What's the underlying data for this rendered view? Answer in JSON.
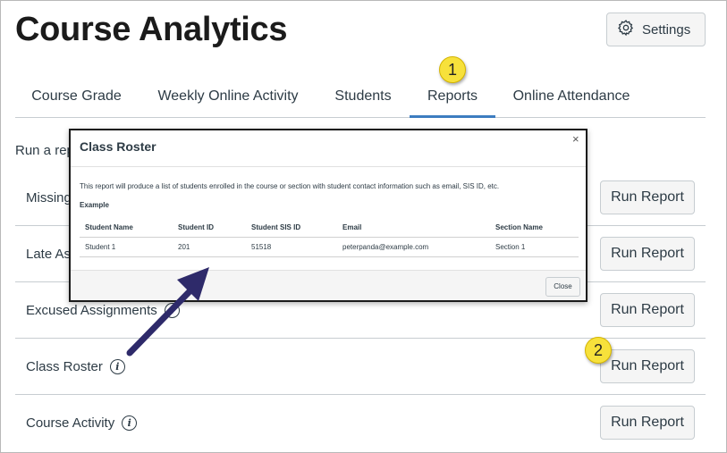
{
  "page": {
    "title": "Course Analytics"
  },
  "header": {
    "settings_label": "Settings",
    "settings_icon": "gear-icon"
  },
  "tabs": [
    {
      "label": "Course Grade",
      "active": false
    },
    {
      "label": "Weekly Online Activity",
      "active": false
    },
    {
      "label": "Students",
      "active": false
    },
    {
      "label": "Reports",
      "active": true
    },
    {
      "label": "Online Attendance",
      "active": false
    }
  ],
  "callouts": {
    "first": "1",
    "second": "2"
  },
  "main": {
    "intro_visible": "Run a rep"
  },
  "reports": [
    {
      "label": "Missing",
      "button": "Run Report"
    },
    {
      "label": "Late As",
      "button": "Run Report"
    },
    {
      "label": "Excused Assignments",
      "button": "Run Report"
    },
    {
      "label": "Class Roster",
      "button": "Run Report"
    },
    {
      "label": "Course Activity",
      "button": "Run Report"
    }
  ],
  "modal": {
    "title": "Class Roster",
    "close_glyph": "×",
    "description": "This report will produce a list of students enrolled in the course or section with student contact information such as email, SIS ID, etc.",
    "example_label": "Example",
    "table": {
      "headers": [
        "Student Name",
        "Student ID",
        "Student SIS ID",
        "Email",
        "Section Name"
      ],
      "rows": [
        [
          "Student 1",
          "201",
          "51518",
          "peterpanda@example.com",
          "Section 1"
        ]
      ]
    },
    "close_button": "Close"
  },
  "colors": {
    "accent": "#3d7dc0",
    "callout": "#f7e13b",
    "arrow": "#2e2a6a"
  }
}
